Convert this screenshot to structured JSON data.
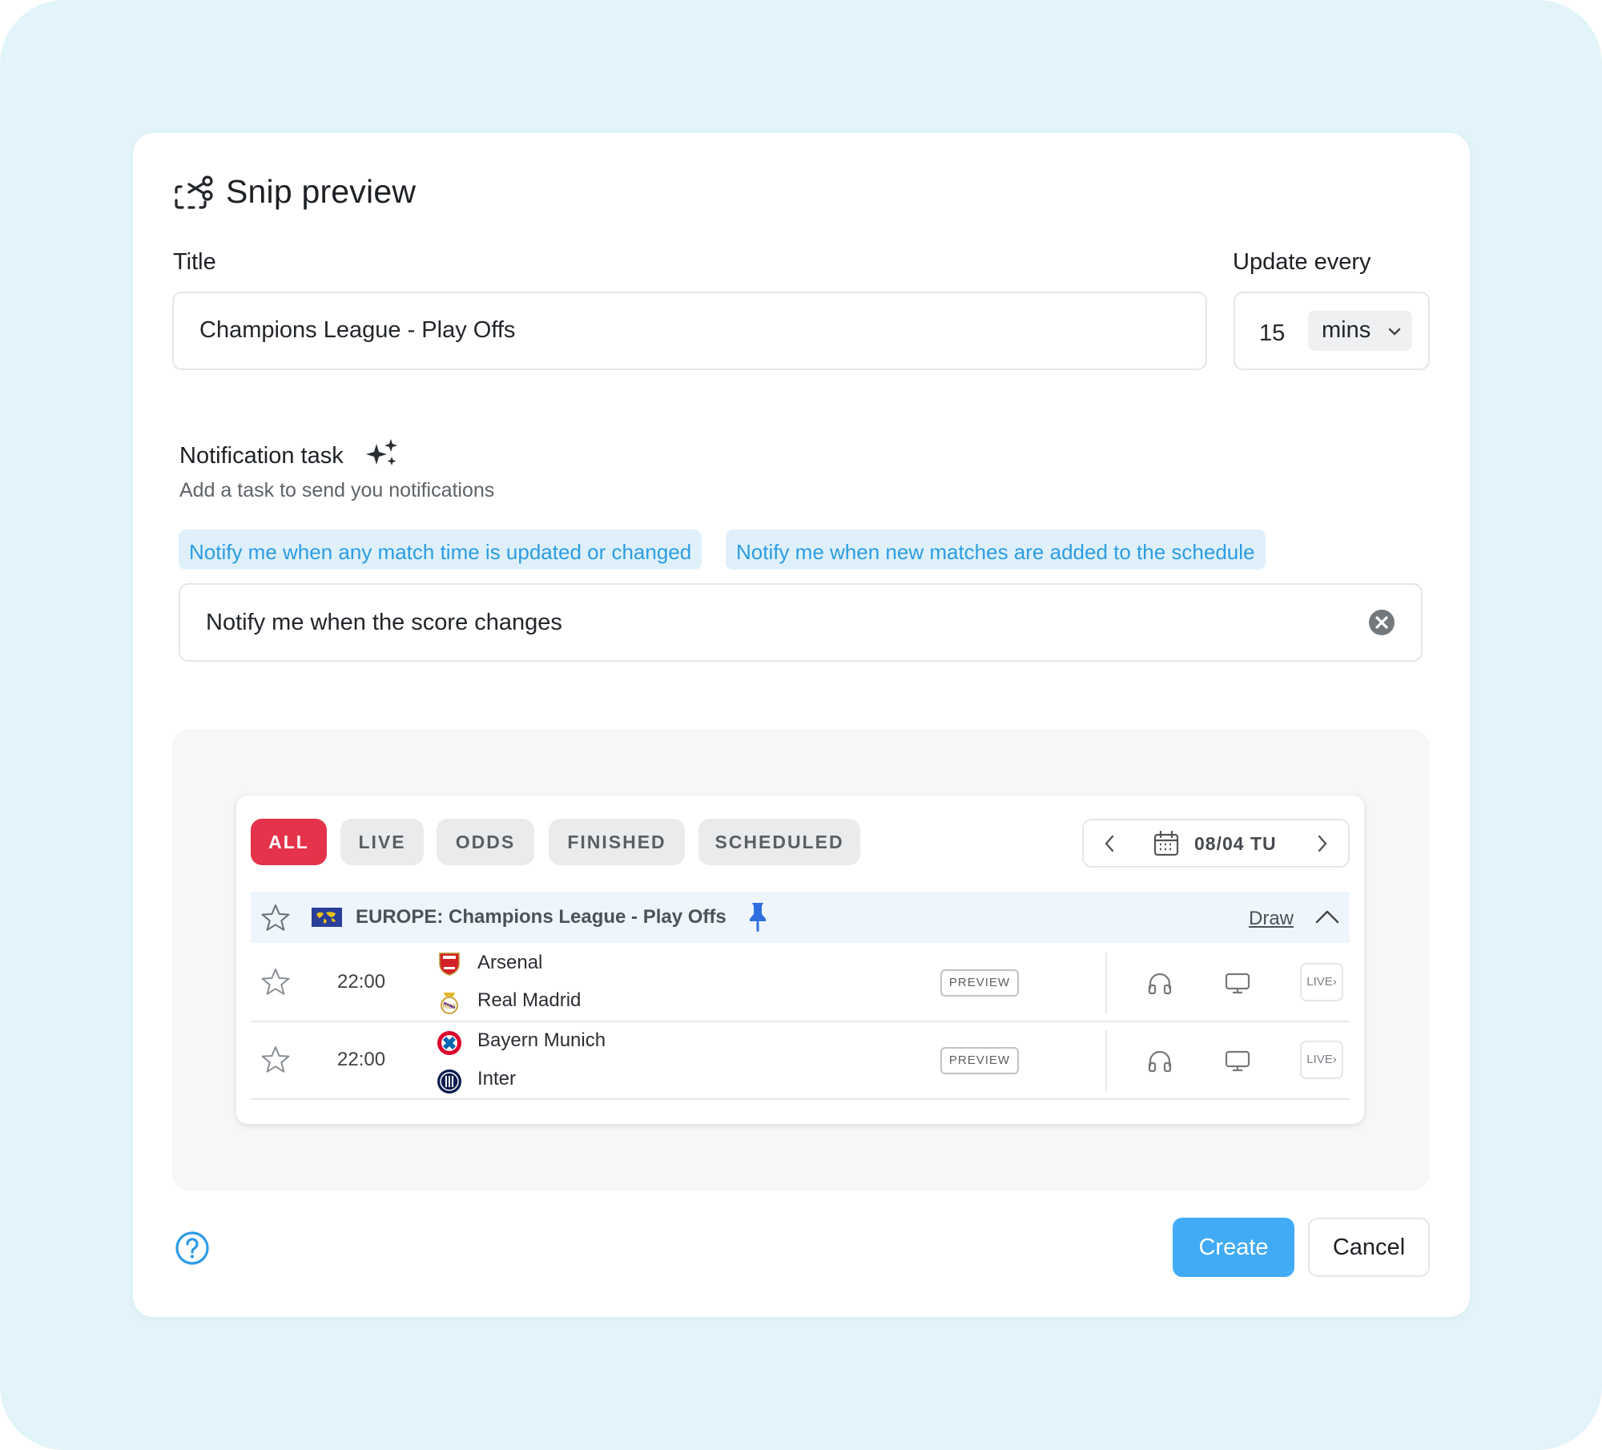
{
  "dialog": {
    "title": "Snip preview",
    "header_icon": "snip-scissors-icon"
  },
  "form": {
    "title_label": "Title",
    "title_value": "Champions League - Play Offs",
    "update_label": "Update every",
    "update_value": "15",
    "update_unit": "mins"
  },
  "notification": {
    "title": "Notification task",
    "subtitle": "Add a task to send you notifications",
    "suggestions": [
      "Notify me when any match time is updated or changed",
      "Notify me when new matches are added to the schedule"
    ],
    "task_value": "Notify me when the score changes"
  },
  "widget": {
    "tabs": [
      "ALL",
      "LIVE",
      "ODDS",
      "FINISHED",
      "SCHEDULED"
    ],
    "active_tab": "ALL",
    "date": "08/04 TU",
    "league": {
      "name": "EUROPE: Champions League - Play Offs",
      "draw_label": "Draw"
    },
    "matches": [
      {
        "time": "22:00",
        "home": "Arsenal",
        "away": "Real Madrid",
        "preview": "PREVIEW",
        "live": "LIVE"
      },
      {
        "time": "22:00",
        "home": "Bayern Munich",
        "away": "Inter",
        "preview": "PREVIEW",
        "live": "LIVE"
      }
    ]
  },
  "footer": {
    "create_label": "Create",
    "cancel_label": "Cancel"
  },
  "colors": {
    "accent_blue": "#42abf6",
    "chip_bg": "#dff0fb",
    "chip_text": "#2b9de3",
    "active_tab": "#e4334a",
    "backdrop": "#e2f4f9"
  }
}
